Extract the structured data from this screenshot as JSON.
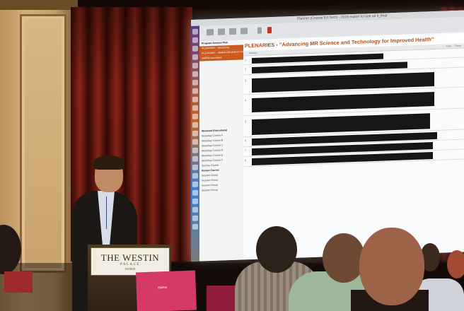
{
  "app": {
    "title_bar": "Planner (Course Ed Tech) - 2016 export to cast ad it_final"
  },
  "sidebar": {
    "items": [
      {
        "label": "Program Session Plan",
        "selected": false,
        "group": true
      },
      {
        "label": "PLENARIES - Advancing",
        "selected": true,
        "group": false
      },
      {
        "label": "PLENARIES - ISMRM RESEARCH FUNDING",
        "selected": true,
        "group": false
      },
      {
        "label": "ISMRM Innovation",
        "selected": true,
        "group": false
      },
      {
        "label": "Weekend Educational",
        "selected": false,
        "group": true
      },
      {
        "label": "Weekday Course A",
        "selected": false,
        "group": false
      },
      {
        "label": "Weekday Course B",
        "selected": false,
        "group": false
      },
      {
        "label": "Weekday Course C",
        "selected": false,
        "group": false
      },
      {
        "label": "Weekday Course D",
        "selected": false,
        "group": false
      },
      {
        "label": "Weekday Course E",
        "selected": false,
        "group": false
      },
      {
        "label": "Weekday Course F",
        "selected": false,
        "group": false
      },
      {
        "label": "Sunrise Course",
        "selected": false,
        "group": false
      },
      {
        "label": "Sunset Course",
        "selected": false,
        "group": true
      },
      {
        "label": "Session Group",
        "selected": false,
        "group": false
      },
      {
        "label": "Session Group",
        "selected": false,
        "group": false
      },
      {
        "label": "Session Group",
        "selected": false,
        "group": false
      },
      {
        "label": "Session Group",
        "selected": false,
        "group": false
      }
    ]
  },
  "document": {
    "heading": "PLENARIES - \"Advancing MR Science and Technology for Improved Health\"",
    "column_name": "Session",
    "column_a": "Date",
    "column_b": "Room",
    "rows": [
      {
        "num": "1",
        "redacted": true
      },
      {
        "num": "2",
        "redacted": true
      },
      {
        "num": "3",
        "redacted": true
      },
      {
        "num": "4",
        "redacted": true
      },
      {
        "num": "5",
        "redacted": true
      },
      {
        "num": "6",
        "redacted": true
      },
      {
        "num": "7",
        "redacted": true
      },
      {
        "num": "8",
        "redacted": true
      }
    ]
  },
  "podium": {
    "brand_name": "THE WESTIN",
    "brand_sub": "PALACE",
    "brand_loc": "MADRID"
  },
  "table_card": {
    "text": "ISMRM"
  }
}
